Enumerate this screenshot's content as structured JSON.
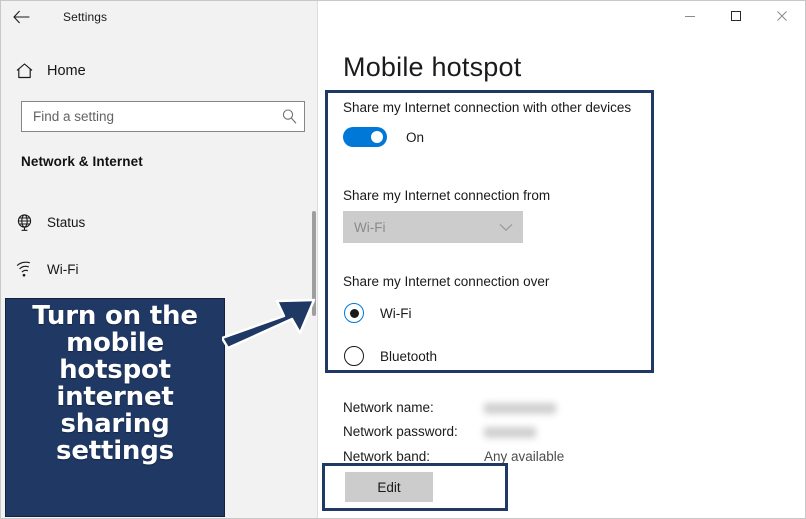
{
  "window": {
    "title": "Settings",
    "back_icon": "back-arrow-icon",
    "controls": {
      "minimize": "minimize-icon",
      "maximize": "maximize-icon",
      "close": "close-icon"
    }
  },
  "sidebar": {
    "home": {
      "label": "Home",
      "icon": "home-icon"
    },
    "search": {
      "placeholder": "Find a setting",
      "icon": "search-icon"
    },
    "section_header": "Network & Internet",
    "items": [
      {
        "label": "Status",
        "icon": "globe-icon"
      },
      {
        "label": "Wi-Fi",
        "icon": "wifi-icon"
      }
    ]
  },
  "main": {
    "page_title": "Mobile hotspot",
    "share_with_devices": {
      "label": "Share my Internet connection with other devices",
      "toggle_state": "On",
      "toggle_on": true
    },
    "share_from": {
      "label": "Share my Internet connection from",
      "selected": "Wi-Fi",
      "disabled": true,
      "caret_icon": "chevron-down-icon"
    },
    "share_over": {
      "label": "Share my Internet connection over",
      "options": [
        {
          "label": "Wi-Fi",
          "selected": true
        },
        {
          "label": "Bluetooth",
          "selected": false
        }
      ]
    },
    "details": [
      {
        "label": "Network name:",
        "value": "",
        "redacted": true
      },
      {
        "label": "Network password:",
        "value": "",
        "redacted": true
      },
      {
        "label": "Network band:",
        "value": "Any available",
        "redacted": false
      }
    ],
    "edit_button": "Edit"
  },
  "annotation": {
    "callout_text": "Turn on the mobile hotspot internet sharing settings",
    "arrow_icon": "arrow-pointer-icon"
  },
  "colors": {
    "accent": "#0078d7",
    "annotation_navy": "#1f3864",
    "sidebar_bg": "#f2f2f2",
    "disabled_control": "#cccccc"
  }
}
